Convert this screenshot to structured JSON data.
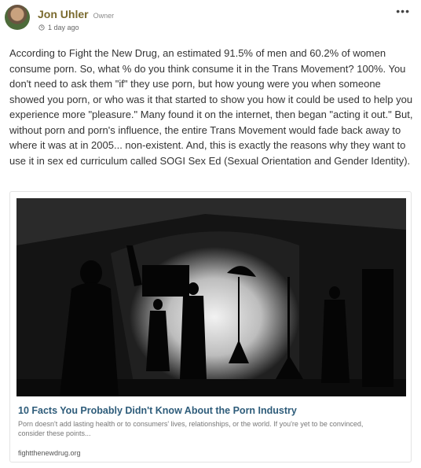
{
  "post": {
    "author": "Jon Uhler",
    "role": "Owner",
    "timestamp": "1 day ago",
    "more_icon": "more-horizontal-icon",
    "body": "According to Fight the New Drug, an estimated 91.5% of men and 60.2% of women consume porn. So, what % do you think consume it in the Trans Movement? 100%. You don't need to ask them \"if\" they use porn, but how young were you when someone showed you porn, or who was it that started to show you how it could be used to help you experience more \"pleasure.\" Many found it on the internet, then began \"acting it out.\" But, without porn and porn's influence, the entire Trans Movement would fade back away to where it was at in 2005... non-existent. And, this is exactly the reasons why they want to use it in sex ed curriculum called SOGI Sex Ed (Sexual Orientation and Gender Identity)."
  },
  "link_preview": {
    "title": "10 Facts You Probably Didn't Know About the Porn Industry",
    "description": "Porn doesn't add lasting health or to consumers' lives, relationships, or the world. If you're yet to be convinced, consider these points...",
    "domain": "fightthenewdrug.org"
  },
  "colors": {
    "author": "#7a6a2e",
    "link_title": "#2e5c7a"
  }
}
